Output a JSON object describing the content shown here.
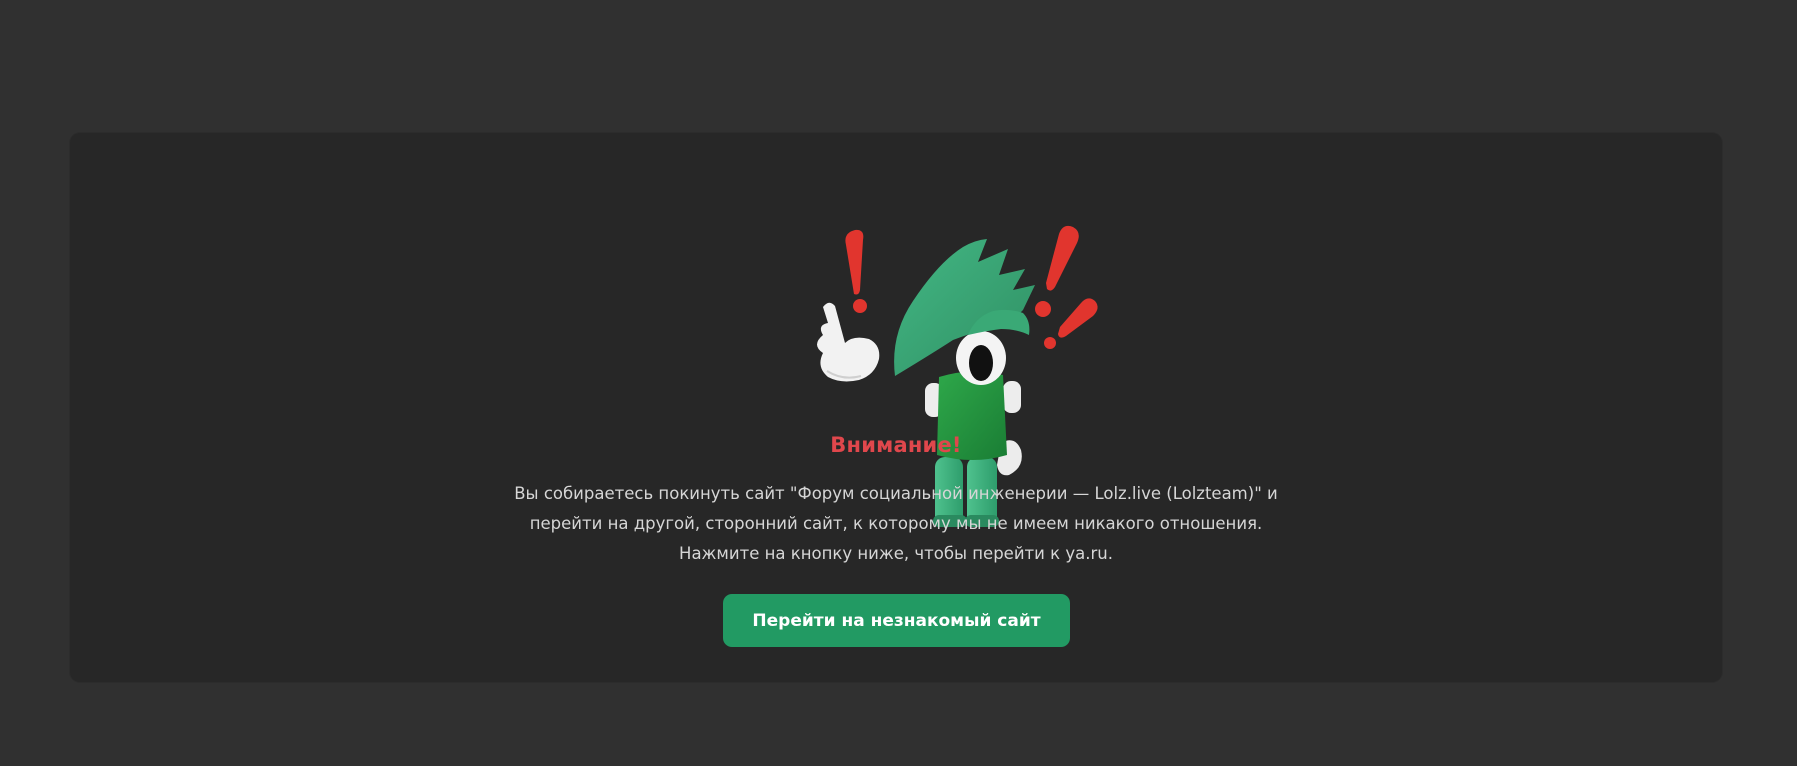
{
  "warning": {
    "title": "Внимание!",
    "message_lines": [
      "Вы собираетесь покинуть сайт \"Форум социальной инженерии — Lolz.live (Lolzteam)\" и",
      "перейти на другой, сторонний сайт, к которому мы не имеем никакого отношения.",
      "Нажмите на кнопку ниже, чтобы перейти к ya.ru."
    ],
    "button_label": "Перейти на незнакомый сайт"
  },
  "illustration": {
    "name": "mascot-alert",
    "items": [
      "exclamation-mark-icon",
      "pointing-hand-icon",
      "green-mascot"
    ]
  },
  "colors": {
    "page_background": "#303030",
    "card_background": "#272727",
    "title": "#e0474c",
    "text": "#d6d6d6",
    "button": "#229a63",
    "button_text": "#ffffff"
  }
}
